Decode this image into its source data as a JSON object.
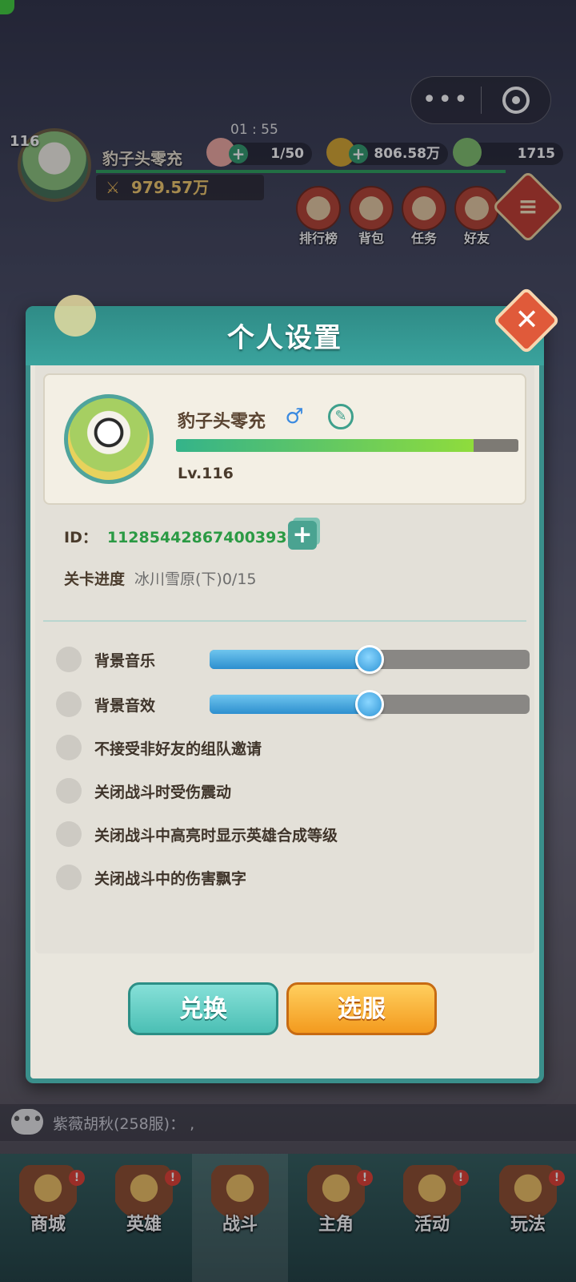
{
  "background": {
    "top_bar": {
      "level": "116",
      "player_name": "豹子头零充",
      "power": "979.57万",
      "timer": "01 : 55",
      "resources": [
        {
          "icon": "peach-icon",
          "value": "1/50"
        },
        {
          "icon": "coin-icon",
          "value": "806.58万"
        },
        {
          "icon": "jade-icon",
          "value": "1715"
        }
      ]
    },
    "top_menu": [
      {
        "label": "排行榜"
      },
      {
        "label": "背包"
      },
      {
        "label": "任务"
      },
      {
        "label": "好友"
      }
    ],
    "chat": {
      "text": "紫薇胡秋(258服)： ,"
    },
    "bottom_nav": [
      {
        "label": "商城"
      },
      {
        "label": "英雄"
      },
      {
        "label": "战斗"
      },
      {
        "label": "主角"
      },
      {
        "label": "活动"
      },
      {
        "label": "玩法"
      }
    ],
    "notice_mark": "!"
  },
  "capsule": {
    "more": "•••"
  },
  "dialog": {
    "title": "个人设置",
    "close": "✕",
    "profile": {
      "name": "豹子头零充",
      "level": "Lv.116",
      "exp_fraction": 0.87,
      "gender_icon": "male-icon",
      "gender_glyph": "♂"
    },
    "id_label": "ID：",
    "id_value": "1128544286740039366",
    "copy_glyph": "+",
    "stage_label": "关卡进度",
    "stage_value": "冰川雪原(下)0/15",
    "settings": {
      "music": {
        "label": "背景音乐",
        "level": 0.5
      },
      "sfx": {
        "label": "背景音效",
        "level": 0.5
      },
      "reject_invite": {
        "label": "不接受非好友的组队邀请"
      },
      "no_shake": {
        "label": "关闭战斗时受伤震动"
      },
      "no_highlight_level": {
        "label": "关闭战斗中高亮时显示英雄合成等级"
      },
      "no_damage_text": {
        "label": "关闭战斗中的伤害飘字"
      }
    },
    "buttons": {
      "exchange": "兑换",
      "select_server": "选服"
    }
  },
  "colors": {
    "teal": "#3a8f8b",
    "id_green": "#2b9a44",
    "button_orange": "#f39a1e",
    "button_teal": "#4bbfb4"
  }
}
